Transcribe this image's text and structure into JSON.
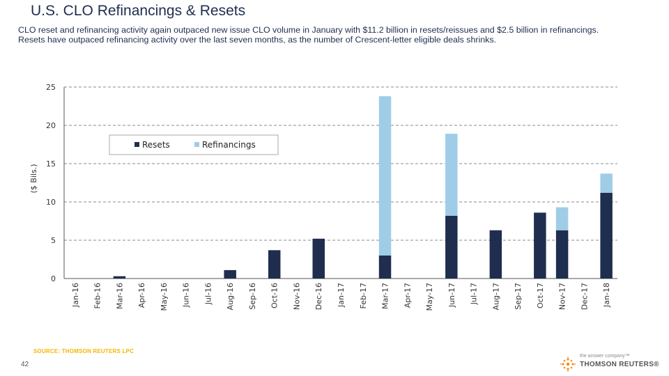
{
  "page": {
    "title": "U.S. CLO Refinancings & Resets",
    "subtitle_lines": [
      "CLO reset and refinancing activity again outpaced new issue CLO volume in January with $11.2 billion in resets/reissues and $2.5 billion in refinancings.",
      "Resets have outpaced refinancing activity over the last seven months, as the number of Crescent-letter eligible deals shrinks."
    ],
    "source": "SOURCE: THOMSON REUTERS LPC",
    "page_number": "42",
    "brand": {
      "tagline": "the answer company™",
      "name": "THOMSON REUTERS®"
    }
  },
  "chart_data": {
    "type": "bar",
    "stacked": true,
    "title": "",
    "xlabel": "",
    "ylabel": "($ Bils.)",
    "ylim": [
      0,
      25
    ],
    "yticks": [
      0,
      5,
      10,
      15,
      20,
      25
    ],
    "grid": true,
    "legend_position": "top-left",
    "categories": [
      "Jan-16",
      "Feb-16",
      "Mar-16",
      "Apr-16",
      "May-16",
      "Jun-16",
      "Jul-16",
      "Aug-16",
      "Sep-16",
      "Oct-16",
      "Nov-16",
      "Dec-16",
      "Jan-17",
      "Feb-17",
      "Mar-17",
      "Apr-17",
      "May-17",
      "Jun-17",
      "Jul-17",
      "Aug-17",
      "Sep-17",
      "Oct-17",
      "Nov-17",
      "Dec-17",
      "Jan-18"
    ],
    "series": [
      {
        "name": "Resets",
        "color": "#1f2d4e",
        "values": [
          0,
          0,
          0.3,
          0,
          0,
          0,
          0,
          1.1,
          0,
          3.7,
          0,
          5.2,
          0,
          0,
          3.0,
          0,
          0,
          8.2,
          0,
          6.3,
          0,
          8.6,
          6.3,
          0,
          11.2
        ]
      },
      {
        "name": "Refinancings",
        "color": "#9fcde8",
        "values": [
          0,
          0,
          0,
          0,
          0,
          0,
          0,
          0,
          0,
          0,
          0,
          0,
          0,
          0,
          20.8,
          0,
          0,
          10.7,
          0,
          0,
          0,
          0,
          3.0,
          0,
          2.5
        ]
      }
    ]
  }
}
